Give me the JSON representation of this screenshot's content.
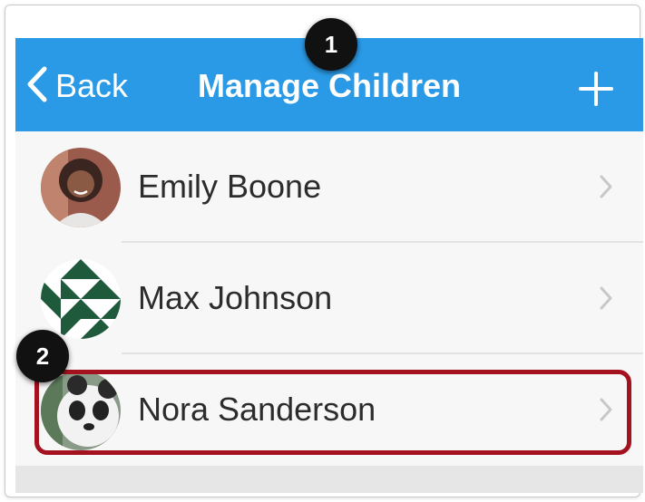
{
  "navbar": {
    "back_label": "Back",
    "title": "Manage Children",
    "add_icon": "plus-icon",
    "background": "#2b9ae6"
  },
  "children": [
    {
      "name": "Emily Boone",
      "avatar": "photo-avatar"
    },
    {
      "name": "Max Johnson",
      "avatar": "pattern-avatar"
    },
    {
      "name": "Nora Sanderson",
      "avatar": "panda-avatar"
    }
  ],
  "callouts": [
    "1",
    "2"
  ],
  "highlight_color": "#a4121f"
}
